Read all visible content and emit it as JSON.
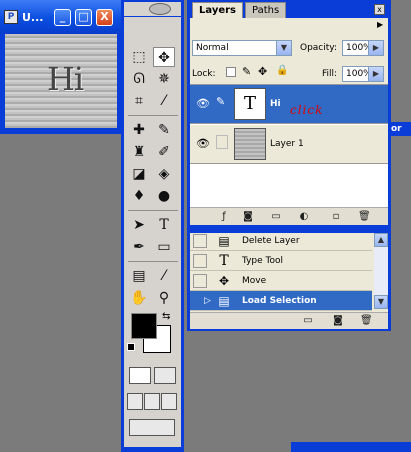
{
  "doc_window": {
    "title": "U...",
    "image_text": "Hi"
  },
  "window_buttons": {
    "minimize": "_",
    "maximize": "□",
    "close": "X"
  },
  "layers": {
    "tabs": [
      "Layers",
      "Paths"
    ],
    "blend_mode": "Normal",
    "opacity_label": "Opacity:",
    "opacity": "100%",
    "lock_label": "Lock:",
    "fill_label": "Fill:",
    "fill": "100%",
    "rows": [
      {
        "name": "Hi",
        "thumb": "T",
        "annotation": "click"
      },
      {
        "name": "Layer 1"
      }
    ]
  },
  "history": {
    "rows": [
      {
        "label": "Delete Layer",
        "icon": "document-icon"
      },
      {
        "label": "Type Tool",
        "icon": "type-icon"
      },
      {
        "label": "Move",
        "icon": "move-icon"
      },
      {
        "label": "Load Selection",
        "icon": "document-icon"
      }
    ]
  },
  "partial_text": {
    "color_palette_edge": "or"
  },
  "colors": {
    "title_blue": "#0a3dd8",
    "selection": "#316ac5",
    "panel": "#ece9d8",
    "annotation": "#e00000"
  }
}
